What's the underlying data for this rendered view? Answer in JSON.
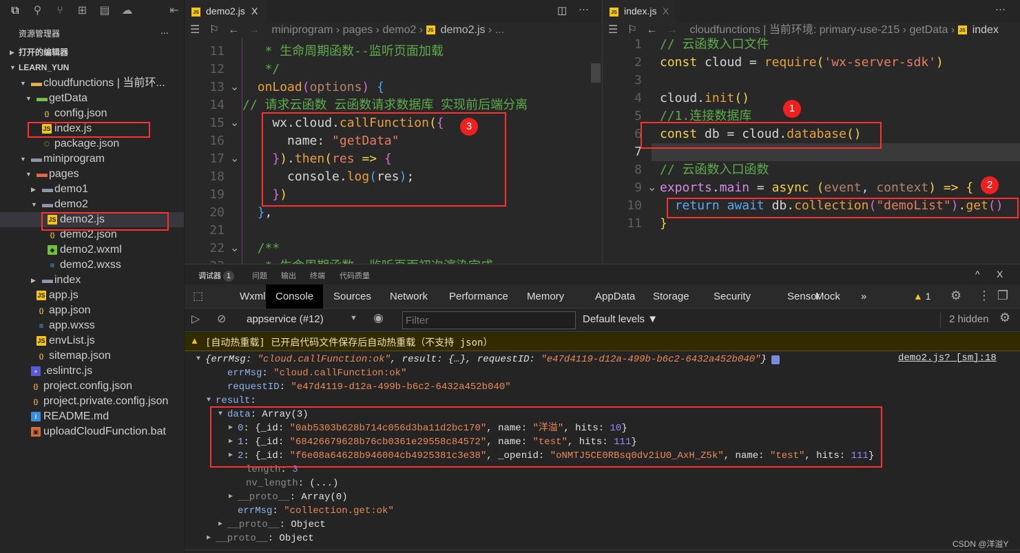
{
  "sidebar": {
    "activity_icons": [
      "files-icon",
      "search-icon",
      "source-control-icon",
      "extensions-icon",
      "storage-icon",
      "docker-icon"
    ],
    "title": "资源管理器",
    "more": "...",
    "sections": [
      {
        "label": "打开的编辑器",
        "expanded": false
      },
      {
        "label": "LEARN_YUN",
        "expanded": true
      }
    ],
    "tree": [
      {
        "label": "cloudfunctions | 当前环...",
        "type": "folder-cloud",
        "depth": 0,
        "expanded": true
      },
      {
        "label": "getData",
        "type": "folder-green",
        "depth": 1,
        "expanded": true
      },
      {
        "label": "config.json",
        "type": "json",
        "depth": 2
      },
      {
        "label": "index.js",
        "type": "js",
        "depth": 2,
        "highlighted": true
      },
      {
        "label": "package.json",
        "type": "node",
        "depth": 2
      },
      {
        "label": "miniprogram",
        "type": "folder",
        "depth": 0,
        "expanded": true
      },
      {
        "label": "pages",
        "type": "folder-red",
        "depth": 1,
        "expanded": true
      },
      {
        "label": "demo1",
        "type": "folder",
        "depth": 2,
        "expanded": false
      },
      {
        "label": "demo2",
        "type": "folder",
        "depth": 2,
        "expanded": true
      },
      {
        "label": "demo2.js",
        "type": "js",
        "depth": 3,
        "highlighted": true,
        "selected": true
      },
      {
        "label": "demo2.json",
        "type": "json",
        "depth": 3
      },
      {
        "label": "demo2.wxml",
        "type": "wxml",
        "depth": 3
      },
      {
        "label": "demo2.wxss",
        "type": "wxss",
        "depth": 3
      },
      {
        "label": "index",
        "type": "folder",
        "depth": 2,
        "expanded": false
      },
      {
        "label": "app.js",
        "type": "js",
        "depth": 1
      },
      {
        "label": "app.json",
        "type": "json",
        "depth": 1
      },
      {
        "label": "app.wxss",
        "type": "wxss",
        "depth": 1
      },
      {
        "label": "envList.js",
        "type": "js",
        "depth": 1
      },
      {
        "label": "sitemap.json",
        "type": "json",
        "depth": 1
      },
      {
        "label": ".eslintrc.js",
        "type": "eslint",
        "depth": 0
      },
      {
        "label": "project.config.json",
        "type": "json",
        "depth": 0
      },
      {
        "label": "project.private.config.json",
        "type": "json",
        "depth": 0
      },
      {
        "label": "README.md",
        "type": "info",
        "depth": 0
      },
      {
        "label": "uploadCloudFunction.bat",
        "type": "bat",
        "depth": 0
      }
    ]
  },
  "editor1": {
    "tab": "demo2.js",
    "close": "X",
    "breadcrumb": [
      "miniprogram",
      "pages",
      "demo2",
      "demo2.js",
      "..."
    ],
    "annotation": "3",
    "lines": [
      {
        "n": "11",
        "tokens": [
          [
            "   * 生命周期函数--监听页面加载",
            "c"
          ]
        ]
      },
      {
        "n": "12",
        "tokens": [
          [
            "   */",
            "c"
          ]
        ]
      },
      {
        "n": "13",
        "fold": true,
        "tokens": [
          [
            "  ",
            "i"
          ],
          [
            "onLoad",
            "f"
          ],
          [
            "(",
            "b2"
          ],
          [
            "options",
            "p"
          ],
          [
            ")",
            "b2"
          ],
          [
            " ",
            "i"
          ],
          [
            "{",
            "b3"
          ]
        ]
      },
      {
        "n": "14",
        "tokens": [
          [
            "// 请求云函数 云函数请求数据库 实现前后端分离",
            "c"
          ]
        ]
      },
      {
        "n": "15",
        "fold": true,
        "tokens": [
          [
            "    wx.cloud.",
            "i"
          ],
          [
            "callFunction",
            "f"
          ],
          [
            "(",
            "b1"
          ],
          [
            "{",
            "b2"
          ]
        ]
      },
      {
        "n": "16",
        "tokens": [
          [
            "      name: ",
            "i"
          ],
          [
            "\"getData\"",
            "s"
          ]
        ]
      },
      {
        "n": "17",
        "fold": true,
        "tokens": [
          [
            "    ",
            "i"
          ],
          [
            "}",
            "b2"
          ],
          [
            ")",
            "b1"
          ],
          [
            ".",
            "i"
          ],
          [
            "then",
            "f"
          ],
          [
            "(",
            "b1"
          ],
          [
            "res",
            "s"
          ],
          [
            " ",
            "i"
          ],
          [
            "=>",
            "k"
          ],
          [
            " ",
            "i"
          ],
          [
            "{",
            "b2"
          ]
        ]
      },
      {
        "n": "18",
        "tokens": [
          [
            "      console.",
            "i"
          ],
          [
            "log",
            "f"
          ],
          [
            "(",
            "b3"
          ],
          [
            "res",
            "i"
          ],
          [
            ")",
            "b3"
          ],
          [
            ";",
            "i"
          ]
        ]
      },
      {
        "n": "19",
        "tokens": [
          [
            "    ",
            "i"
          ],
          [
            "}",
            "b2"
          ],
          [
            ")",
            "b1"
          ]
        ]
      },
      {
        "n": "20",
        "tokens": [
          [
            "  ",
            "i"
          ],
          [
            "}",
            "b3"
          ],
          [
            ",",
            "i"
          ]
        ]
      },
      {
        "n": "21",
        "tokens": []
      },
      {
        "n": "22",
        "fold": true,
        "tokens": [
          [
            "  /**",
            "c"
          ]
        ]
      },
      {
        "n": "23",
        "tokens": [
          [
            "   * 生命周期函数--监听页面初次渲染完成",
            "c"
          ]
        ]
      }
    ]
  },
  "editor2": {
    "tab": "index.js",
    "close": "X",
    "breadcrumb": [
      "cloudfunctions | 当前环境: primary-use-215",
      "getData",
      "index"
    ],
    "annotations": [
      "1",
      "2"
    ],
    "lines": [
      {
        "n": "1",
        "tokens": [
          [
            "// 云函数入口文件",
            "c"
          ]
        ]
      },
      {
        "n": "2",
        "tokens": [
          [
            "const",
            "k"
          ],
          [
            " cloud = ",
            "i"
          ],
          [
            "require",
            "f"
          ],
          [
            "(",
            "b1"
          ],
          [
            "'wx-server-sdk'",
            "s"
          ],
          [
            ")",
            "b1"
          ]
        ]
      },
      {
        "n": "3",
        "tokens": []
      },
      {
        "n": "4",
        "tokens": [
          [
            "cloud.",
            "i"
          ],
          [
            "init",
            "f"
          ],
          [
            "()",
            "b1"
          ]
        ]
      },
      {
        "n": "5",
        "tokens": [
          [
            "//1.连接数据库",
            "c"
          ]
        ]
      },
      {
        "n": "6",
        "tokens": [
          [
            "const",
            "k"
          ],
          [
            " db = cloud.",
            "i"
          ],
          [
            "database",
            "f"
          ],
          [
            "()",
            "b1"
          ]
        ]
      },
      {
        "n": "7",
        "current": true,
        "tokens": []
      },
      {
        "n": "8",
        "tokens": [
          [
            "// 云函数入口函数",
            "c"
          ]
        ]
      },
      {
        "n": "9",
        "fold": true,
        "tokens": [
          [
            "exports",
            "e"
          ],
          [
            ".",
            "i"
          ],
          [
            "main",
            "e"
          ],
          [
            " = ",
            "i"
          ],
          [
            "async",
            "k"
          ],
          [
            " ",
            "i"
          ],
          [
            "(",
            "b1"
          ],
          [
            "event",
            "p"
          ],
          [
            ", ",
            "i"
          ],
          [
            "context",
            "p"
          ],
          [
            ")",
            "b1"
          ],
          [
            " ",
            "i"
          ],
          [
            "=>",
            "k"
          ],
          [
            " ",
            "i"
          ],
          [
            "{",
            "b1"
          ]
        ]
      },
      {
        "n": "10",
        "tokens": [
          [
            "  ",
            "i"
          ],
          [
            "return",
            "r"
          ],
          [
            " ",
            "i"
          ],
          [
            "await",
            "r"
          ],
          [
            " db.",
            "i"
          ],
          [
            "collection",
            "f"
          ],
          [
            "(",
            "b2"
          ],
          [
            "\"demoList\"",
            "s"
          ],
          [
            ")",
            "b2"
          ],
          [
            ".",
            "i"
          ],
          [
            "get",
            "f"
          ],
          [
            "()",
            "b2"
          ]
        ]
      },
      {
        "n": "11",
        "tokens": [
          [
            "}",
            "b1"
          ]
        ]
      }
    ]
  },
  "panel": {
    "tabs": [
      "调试器",
      "问题",
      "输出",
      "终端",
      "代码质量"
    ],
    "debugger_badge": "1",
    "devtools_tabs": [
      "Wxml",
      "Console",
      "Sources",
      "Network",
      "Performance",
      "Memory",
      "AppData",
      "Storage",
      "Security",
      "Sensor",
      "Mock",
      "»"
    ],
    "active_devtools_tab": "Console",
    "warning_count": "1",
    "context": "appservice (#12)",
    "filter_placeholder": "Filter",
    "levels": "Default levels ▼",
    "hidden": "2 hidden",
    "warning_message": "[自动热重载] 已开启代码文件保存后自动热重载（不支持 json）",
    "source_link": "demo2.js? [sm]:18",
    "console_lines": [
      {
        "arrow": "▼",
        "indent": 0,
        "italic": true,
        "tokens": [
          [
            "{",
            "cp"
          ],
          [
            "errMsg",
            "cp"
          ],
          [
            ": ",
            "cp"
          ],
          [
            "\"cloud.callFunction:ok\"",
            "cs"
          ],
          [
            ", result: {…}, requestID: ",
            "cp"
          ],
          [
            "\"e47d4119-d12a-499b-b6c2-6432a452b040\"",
            "cs"
          ],
          [
            "}",
            "cp"
          ]
        ]
      },
      {
        "indent": 2,
        "tokens": [
          [
            "errMsg",
            "ck"
          ],
          [
            ": ",
            "cp"
          ],
          [
            "\"cloud.callFunction:ok\"",
            "cs"
          ]
        ]
      },
      {
        "indent": 2,
        "tokens": [
          [
            "requestID",
            "ck"
          ],
          [
            ": ",
            "cp"
          ],
          [
            "\"e47d4119-d12a-499b-b6c2-6432a452b040\"",
            "cs"
          ]
        ]
      },
      {
        "arrow": "▼",
        "indent": 1,
        "tokens": [
          [
            "result",
            "ck"
          ],
          [
            ":",
            "cp"
          ]
        ]
      },
      {
        "arrow": "▼",
        "indent": 2,
        "tokens": [
          [
            "data",
            "ck"
          ],
          [
            ": Array(3)",
            "cp"
          ]
        ]
      },
      {
        "arrow": "▶",
        "indent": 3,
        "tokens": [
          [
            "0",
            "ck"
          ],
          [
            ": {_id: ",
            "cp"
          ],
          [
            "\"0ab5303b628b714c056d3ba11d2bc170\"",
            "cs"
          ],
          [
            ", name: ",
            "cp"
          ],
          [
            "\"洋溢\"",
            "cs"
          ],
          [
            ", hits: ",
            "cp"
          ],
          [
            "10",
            "cn"
          ],
          [
            "}",
            "cp"
          ]
        ]
      },
      {
        "arrow": "▶",
        "indent": 3,
        "tokens": [
          [
            "1",
            "ck"
          ],
          [
            ": {_id: ",
            "cp"
          ],
          [
            "\"68426679628b76cb0361e29558c84572\"",
            "cs"
          ],
          [
            ", name: ",
            "cp"
          ],
          [
            "\"test\"",
            "cs"
          ],
          [
            ", hits: ",
            "cp"
          ],
          [
            "111",
            "cn"
          ],
          [
            "}",
            "cp"
          ]
        ]
      },
      {
        "arrow": "▶",
        "indent": 3,
        "tokens": [
          [
            "2",
            "ck"
          ],
          [
            ": {_id: ",
            "cp"
          ],
          [
            "\"f6e08a64628b946004cb4925381c3e38\"",
            "cs"
          ],
          [
            ", _openid: ",
            "cp"
          ],
          [
            "\"oNMTJ5CE0RBsq0dv2iU0_AxH_Z5k\"",
            "cs"
          ],
          [
            ", name: ",
            "cp"
          ],
          [
            "\"test\"",
            "cs"
          ],
          [
            ", hits: ",
            "cp"
          ],
          [
            "111",
            "cn"
          ],
          [
            "}",
            "cp"
          ]
        ]
      },
      {
        "indent": 4,
        "tokens": [
          [
            "length",
            "cg"
          ],
          [
            ": ",
            "cp"
          ],
          [
            "3",
            "cn"
          ]
        ]
      },
      {
        "indent": 4,
        "tokens": [
          [
            "nv_length",
            "cg"
          ],
          [
            ": (...)",
            "cp"
          ]
        ]
      },
      {
        "arrow": "▶",
        "indent": 3,
        "tokens": [
          [
            "__proto__",
            "cg"
          ],
          [
            ": Array(0)",
            "cp"
          ]
        ]
      },
      {
        "indent": 3,
        "tokens": [
          [
            "errMsg",
            "ck"
          ],
          [
            ": ",
            "cp"
          ],
          [
            "\"collection.get:ok\"",
            "cs"
          ]
        ]
      },
      {
        "arrow": "▶",
        "indent": 2,
        "tokens": [
          [
            "__proto__",
            "cg"
          ],
          [
            ": Object",
            "cp"
          ]
        ]
      },
      {
        "arrow": "▶",
        "indent": 1,
        "tokens": [
          [
            "__proto__",
            "cg"
          ],
          [
            ": Object",
            "cp"
          ]
        ]
      }
    ]
  },
  "watermark": "CSDN @洋溢Y",
  "colors": {
    "annotation_red": "#ff3030",
    "active_tab_bg": "#000000",
    "warning_bg": "#332b00"
  }
}
